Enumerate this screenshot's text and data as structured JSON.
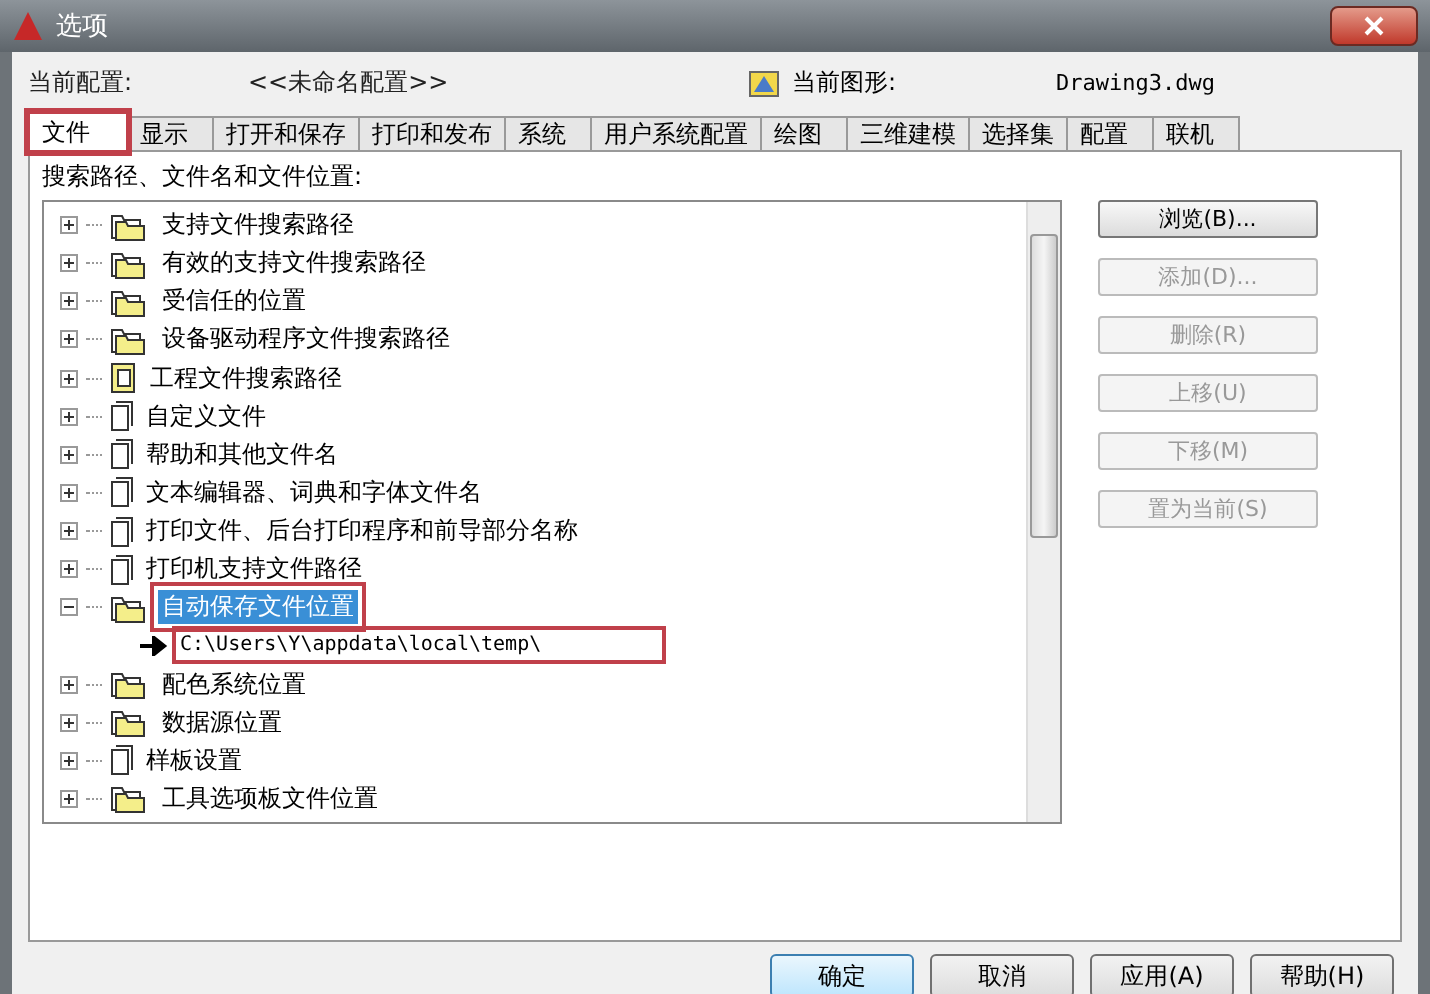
{
  "window": {
    "title": "选项"
  },
  "profile": {
    "label": "当前配置:",
    "value": "<<未命名配置>>",
    "drawing_label": "当前图形:",
    "drawing_value": "Drawing3.dwg"
  },
  "tabs": [
    {
      "label": "文件",
      "selected": true,
      "highlighted": true
    },
    {
      "label": "显示",
      "selected": false,
      "highlighted": false
    },
    {
      "label": "打开和保存",
      "selected": false,
      "highlighted": false
    },
    {
      "label": "打印和发布",
      "selected": false,
      "highlighted": false
    },
    {
      "label": "系统",
      "selected": false,
      "highlighted": false
    },
    {
      "label": "用户系统配置",
      "selected": false,
      "highlighted": false
    },
    {
      "label": "绘图",
      "selected": false,
      "highlighted": false
    },
    {
      "label": "三维建模",
      "selected": false,
      "highlighted": false
    },
    {
      "label": "选择集",
      "selected": false,
      "highlighted": false
    },
    {
      "label": "配置",
      "selected": false,
      "highlighted": false
    },
    {
      "label": "联机",
      "selected": false,
      "highlighted": false
    }
  ],
  "tree_label": "搜索路径、文件名和文件位置:",
  "tree": [
    {
      "label": "支持文件搜索路径",
      "kind": "folders",
      "expanded": false,
      "selected": false,
      "highlighted": false
    },
    {
      "label": "有效的支持文件搜索路径",
      "kind": "folders",
      "expanded": false,
      "selected": false,
      "highlighted": false
    },
    {
      "label": "受信任的位置",
      "kind": "folders",
      "expanded": false,
      "selected": false,
      "highlighted": false
    },
    {
      "label": "设备驱动程序文件搜索路径",
      "kind": "folders",
      "expanded": false,
      "selected": false,
      "highlighted": false
    },
    {
      "label": "工程文件搜索路径",
      "kind": "project",
      "expanded": false,
      "selected": false,
      "highlighted": false
    },
    {
      "label": "自定义文件",
      "kind": "file",
      "expanded": false,
      "selected": false,
      "highlighted": false
    },
    {
      "label": "帮助和其他文件名",
      "kind": "file",
      "expanded": false,
      "selected": false,
      "highlighted": false
    },
    {
      "label": "文本编辑器、词典和字体文件名",
      "kind": "file",
      "expanded": false,
      "selected": false,
      "highlighted": false
    },
    {
      "label": "打印文件、后台打印程序和前导部分名称",
      "kind": "file",
      "expanded": false,
      "selected": false,
      "highlighted": false
    },
    {
      "label": "打印机支持文件路径",
      "kind": "file",
      "expanded": false,
      "selected": false,
      "highlighted": false
    },
    {
      "label": "自动保存文件位置",
      "kind": "folders",
      "expanded": true,
      "selected": true,
      "highlighted": true,
      "children": [
        {
          "label": "C:\\Users\\Y\\appdata\\local\\temp\\",
          "kind": "path",
          "highlighted": true
        }
      ]
    },
    {
      "label": "配色系统位置",
      "kind": "folders",
      "expanded": false,
      "selected": false,
      "highlighted": false
    },
    {
      "label": "数据源位置",
      "kind": "folders",
      "expanded": false,
      "selected": false,
      "highlighted": false
    },
    {
      "label": "样板设置",
      "kind": "file",
      "expanded": false,
      "selected": false,
      "highlighted": false
    },
    {
      "label": "工具选项板文件位置",
      "kind": "folders",
      "expanded": false,
      "selected": false,
      "highlighted": false
    }
  ],
  "side_buttons": [
    {
      "label": "浏览(B)...",
      "disabled": false
    },
    {
      "label": "添加(D)...",
      "disabled": true
    },
    {
      "label": "删除(R)",
      "disabled": true
    },
    {
      "label": "上移(U)",
      "disabled": true
    },
    {
      "label": "下移(M)",
      "disabled": true
    },
    {
      "label": "置为当前(S)",
      "disabled": true
    }
  ],
  "footer_buttons": [
    {
      "label": "确定",
      "default": true
    },
    {
      "label": "取消",
      "default": false
    },
    {
      "label": "应用(A)",
      "default": false
    },
    {
      "label": "帮助(H)",
      "default": false
    }
  ]
}
